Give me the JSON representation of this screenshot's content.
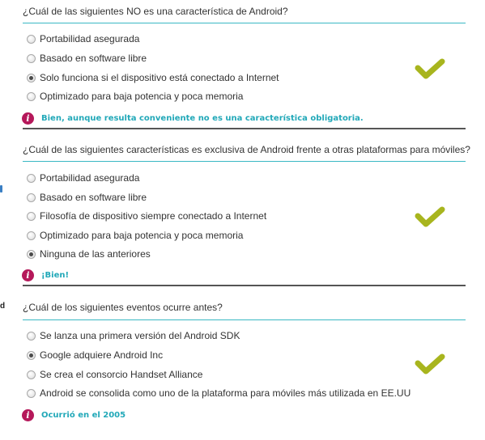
{
  "questions": [
    {
      "text": "¿Cuál de las siguientes NO es una característica de Android?",
      "options": [
        {
          "label": "Portabilidad asegurada",
          "checked": false
        },
        {
          "label": "Basado en software libre",
          "checked": false
        },
        {
          "label": "Solo funciona si el dispositivo está conectado a Internet",
          "checked": true
        },
        {
          "label": "Optimizado para baja potencia y poca memoria",
          "checked": false
        }
      ],
      "feedback": "Bien, aunque resulta conveniente no es una característica obligatoria."
    },
    {
      "text": "¿Cuál de las siguientes características es exclusiva de Android frente a otras plataformas para móviles?",
      "options": [
        {
          "label": "Portabilidad asegurada",
          "checked": false
        },
        {
          "label": "Basado en software libre",
          "checked": false
        },
        {
          "label": "Filosofía de dispositivo siempre conectado a Internet",
          "checked": false
        },
        {
          "label": "Optimizado para baja potencia y poca memoria",
          "checked": false
        },
        {
          "label": "Ninguna de las anteriores",
          "checked": true
        }
      ],
      "feedback": "¡Bien!"
    },
    {
      "text": "¿Cuál de los siguientes eventos ocurre antes?",
      "options": [
        {
          "label": "Se lanza una primera versión del Android SDK",
          "checked": false
        },
        {
          "label": "Google adquiere Android Inc",
          "checked": true
        },
        {
          "label": "Se crea el consorcio Handset Alliance",
          "checked": false
        },
        {
          "label": "Android se consolida como uno de la plataforma para móviles más utilizada en EE.UU",
          "checked": false
        }
      ],
      "feedback": "Ocurrió en el 2005"
    }
  ],
  "icons": {
    "feedback": "info-icon",
    "result": "checkmark-icon"
  },
  "edge": {
    "letter": "d"
  },
  "colors": {
    "accent_teal": "#21a8b8",
    "rule_teal": "#3ab8c4",
    "check_green": "#a8b51e",
    "info_magenta": "#b5185a"
  }
}
